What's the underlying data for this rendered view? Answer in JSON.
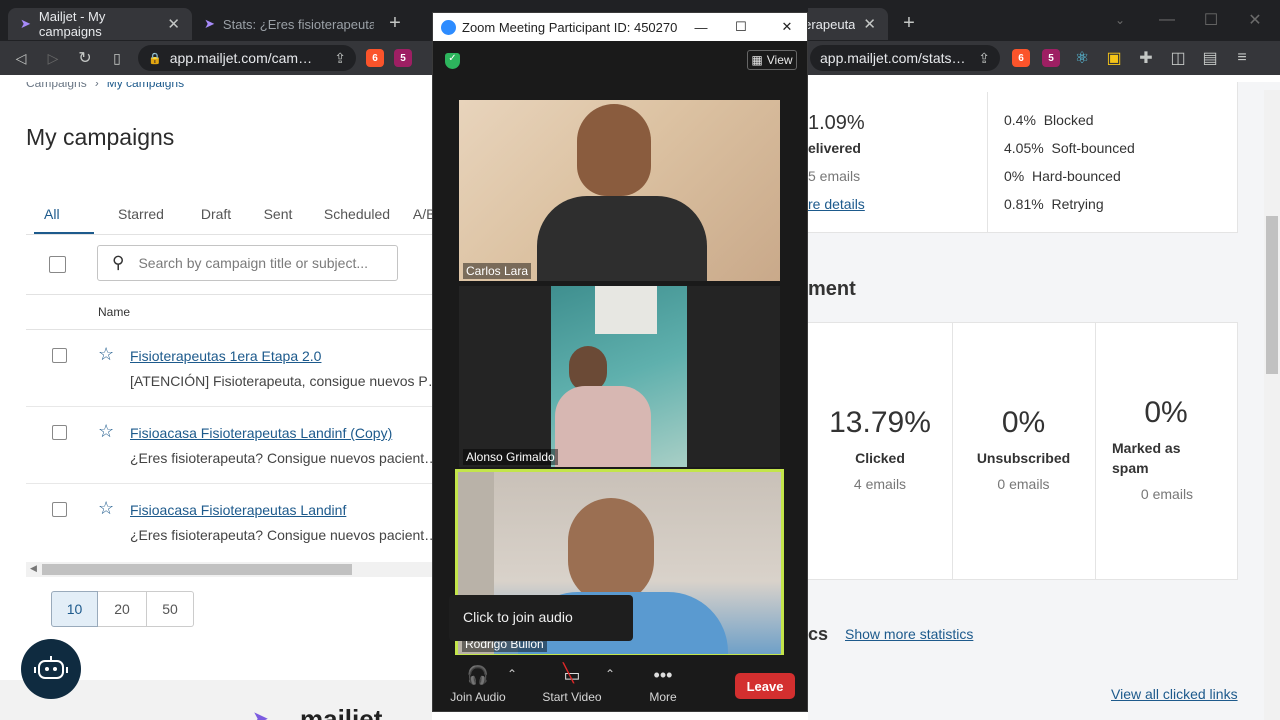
{
  "browser": {
    "tabs": [
      {
        "title": "Mailjet - My campaigns"
      },
      {
        "title": "Stats: ¿Eres fisioterapeuta?"
      },
      {
        "title": "Stats: ¿Eres fisioterapeuta"
      }
    ],
    "left_url": "app.mailjet.com/cam…",
    "right_url": "app.mailjet.com/stats…",
    "ext_badge_1": "6",
    "ext_badge_2": "5"
  },
  "campaigns": {
    "breadcrumb": [
      "Campaigns",
      "My campaigns"
    ],
    "page_title": "My campaigns",
    "filter_tabs": [
      "All",
      "Starred",
      "Draft",
      "Sent",
      "Scheduled",
      "A/B te"
    ],
    "search_placeholder": "Search by campaign title or subject...",
    "column_name": "Name",
    "rows": [
      {
        "title": "Fisioterapeutas 1era Etapa 2.0",
        "subject": "[ATENCIÓN] Fisioterapeuta, consigue nuevos P…"
      },
      {
        "title": "Fisioacasa Fisioterapeutas Landinf (Copy)",
        "subject": "¿Eres fisioterapeuta? Consigue nuevos pacient…"
      },
      {
        "title": "Fisioacasa Fisioterapeutas Landinf",
        "subject": "¿Eres fisioterapeuta? Consigue nuevos pacient…"
      }
    ],
    "page_sizes": [
      "10",
      "20",
      "50"
    ],
    "footer_logo": "mailjet"
  },
  "stats": {
    "delivered_pct": "1.09%",
    "delivered_label": "elivered",
    "delivered_emails": "5 emails",
    "more_details": "re details",
    "bounces": [
      {
        "pct": "0.4%",
        "label": "Blocked"
      },
      {
        "pct": "4.05%",
        "label": "Soft-bounced"
      },
      {
        "pct": "0%",
        "label": "Hard-bounced"
      },
      {
        "pct": "0.81%",
        "label": "Retrying"
      }
    ],
    "engagement_heading": "ment",
    "metrics": [
      {
        "pct": "13.79%",
        "label": "Clicked",
        "sub": "4 emails"
      },
      {
        "pct": "0%",
        "label": "Unsubscribed",
        "sub": "0 emails"
      },
      {
        "pct": "0%",
        "label": "Marked as spam",
        "sub": "0 emails"
      }
    ],
    "stats_heading": "cs",
    "show_more": "Show more statistics",
    "view_all": "View all clicked links"
  },
  "zoom": {
    "title": "Zoom Meeting Participant ID: 450270",
    "view_label": "View",
    "participants": [
      "Carlos Lara",
      "Alonso Grimaldo",
      "Rodrigo Bullon"
    ],
    "tooltip": "Click to join audio",
    "buttons": {
      "join_audio": "Join Audio",
      "start_video": "Start Video",
      "more": "More",
      "leave": "Leave"
    }
  }
}
